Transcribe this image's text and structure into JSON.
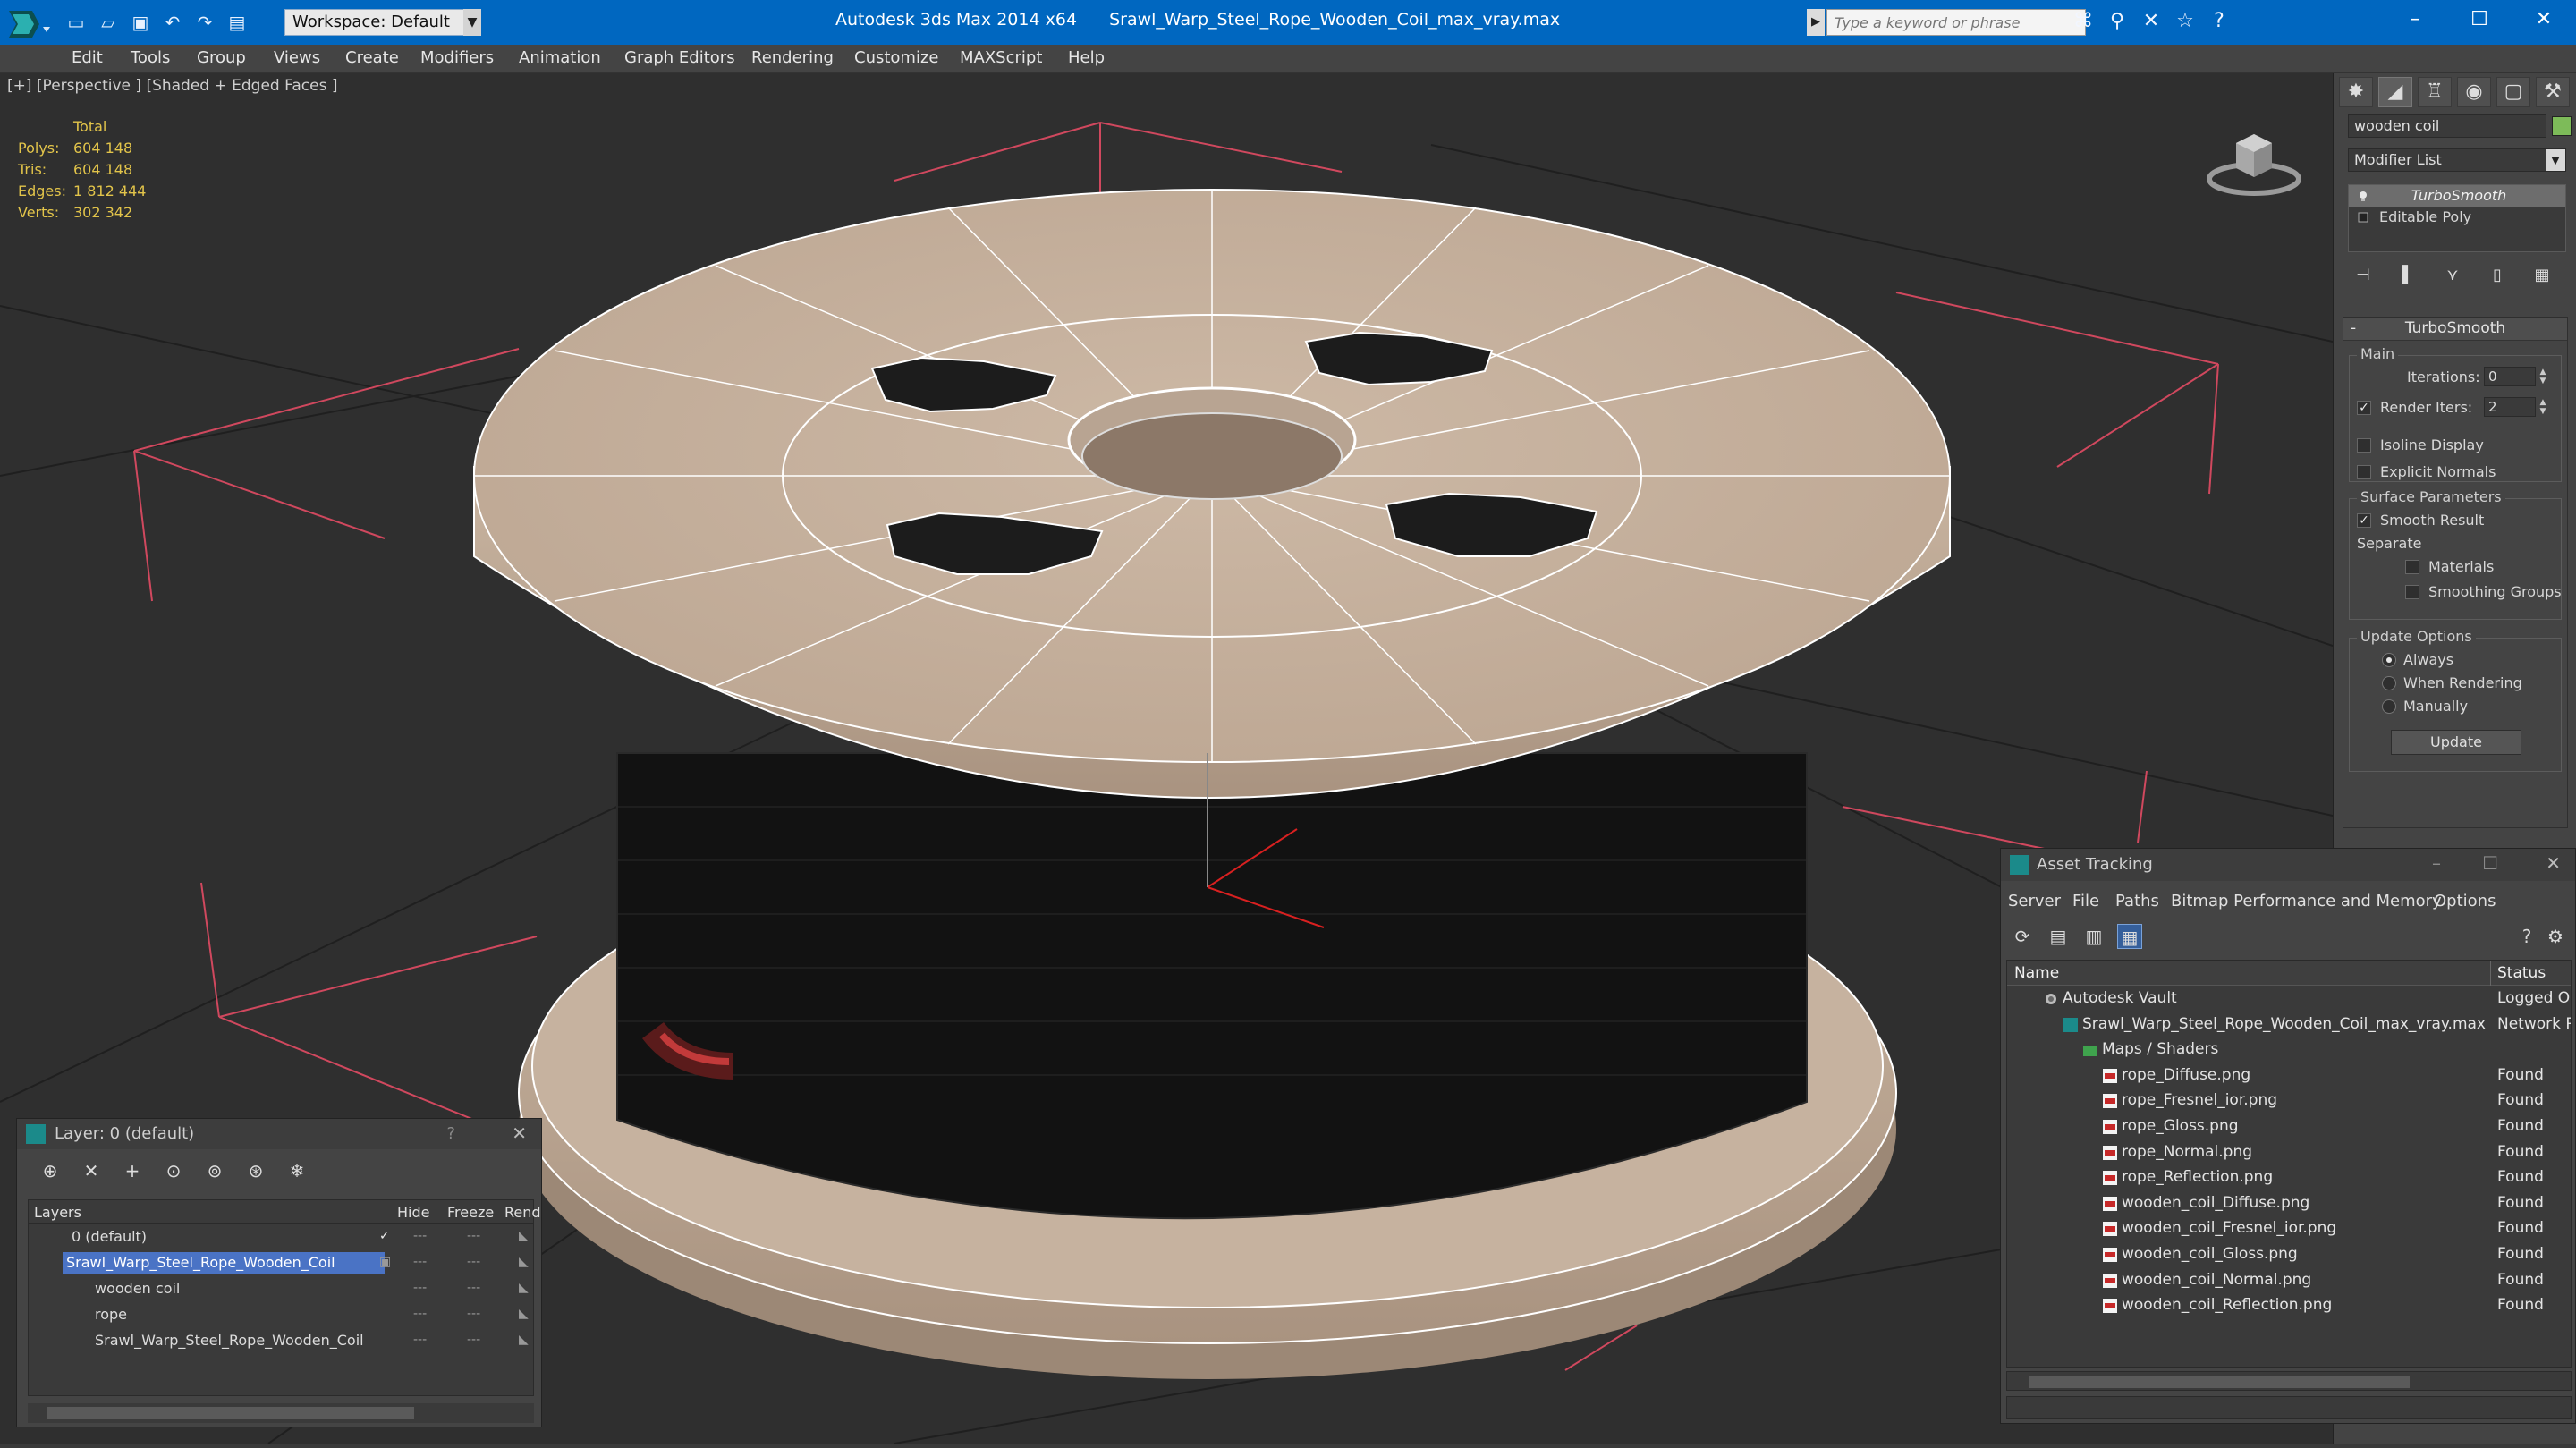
{
  "titlebar": {
    "app_title": "Autodesk 3ds Max  2014 x64",
    "file_name": "Srawl_Warp_Steel_Rope_Wooden_Coil_max_vray.max",
    "workspace": "Workspace: Default",
    "search_placeholder": "Type a keyword or phrase"
  },
  "menu": [
    "Edit",
    "Tools",
    "Group",
    "Views",
    "Create",
    "Modifiers",
    "Animation",
    "Graph Editors",
    "Rendering",
    "Customize",
    "MAXScript",
    "Help"
  ],
  "viewport": {
    "label": "[+] [Perspective ] [Shaded + Edged Faces ]",
    "stats": {
      "total_label": "Total",
      "polys_label": "Polys:",
      "polys": "604 148",
      "tris_label": "Tris:",
      "tris": "604 148",
      "edges_label": "Edges:",
      "edges": "1 812 444",
      "verts_label": "Verts:",
      "verts": "302 342"
    }
  },
  "command_panel": {
    "object_name": "wooden coil",
    "modifier_list": "Modifier List",
    "stack": [
      "TurboSmooth",
      "Editable Poly"
    ],
    "rollout_title": "TurboSmooth",
    "main_group": "Main",
    "iterations_label": "Iterations:",
    "iterations": "0",
    "render_iters_label": "Render Iters:",
    "render_iters": "2",
    "isoline": "Isoline Display",
    "explicit_normals": "Explicit Normals",
    "surface_group": "Surface Parameters",
    "smooth_result": "Smooth Result",
    "separate": "Separate",
    "materials": "Materials",
    "smoothing_groups": "Smoothing Groups",
    "update_group": "Update Options",
    "always": "Always",
    "when_rendering": "When Rendering",
    "manually": "Manually",
    "update_btn": "Update",
    "colors": {
      "object_color": "#7dbb59"
    }
  },
  "layers": {
    "title": "Layer: 0 (default)",
    "help": "?",
    "col_layers": "Layers",
    "col_hide": "Hide",
    "col_freeze": "Freeze",
    "col_render": "Rend",
    "rows": [
      {
        "name": "0 (default)"
      },
      {
        "name": "Srawl_Warp_Steel_Rope_Wooden_Coil"
      },
      {
        "name": "wooden coil"
      },
      {
        "name": "rope"
      },
      {
        "name": "Srawl_Warp_Steel_Rope_Wooden_Coil"
      }
    ]
  },
  "assets": {
    "title": "Asset Tracking",
    "menu": [
      "Server",
      "File",
      "Paths",
      "Bitmap Performance and Memory",
      "Options"
    ],
    "col_name": "Name",
    "col_status": "Status",
    "rows": [
      {
        "name": "Autodesk Vault",
        "status": "Logged Ou"
      },
      {
        "name": "Srawl_Warp_Steel_Rope_Wooden_Coil_max_vray.max",
        "status": "Network P"
      },
      {
        "name": "Maps / Shaders",
        "status": ""
      },
      {
        "name": "rope_Diffuse.png",
        "status": "Found"
      },
      {
        "name": "rope_Fresnel_ior.png",
        "status": "Found"
      },
      {
        "name": "rope_Gloss.png",
        "status": "Found"
      },
      {
        "name": "rope_Normal.png",
        "status": "Found"
      },
      {
        "name": "rope_Reflection.png",
        "status": "Found"
      },
      {
        "name": "wooden_coil_Diffuse.png",
        "status": "Found"
      },
      {
        "name": "wooden_coil_Fresnel_ior.png",
        "status": "Found"
      },
      {
        "name": "wooden_coil_Gloss.png",
        "status": "Found"
      },
      {
        "name": "wooden_coil_Normal.png",
        "status": "Found"
      },
      {
        "name": "wooden_coil_Reflection.png",
        "status": "Found"
      }
    ]
  }
}
